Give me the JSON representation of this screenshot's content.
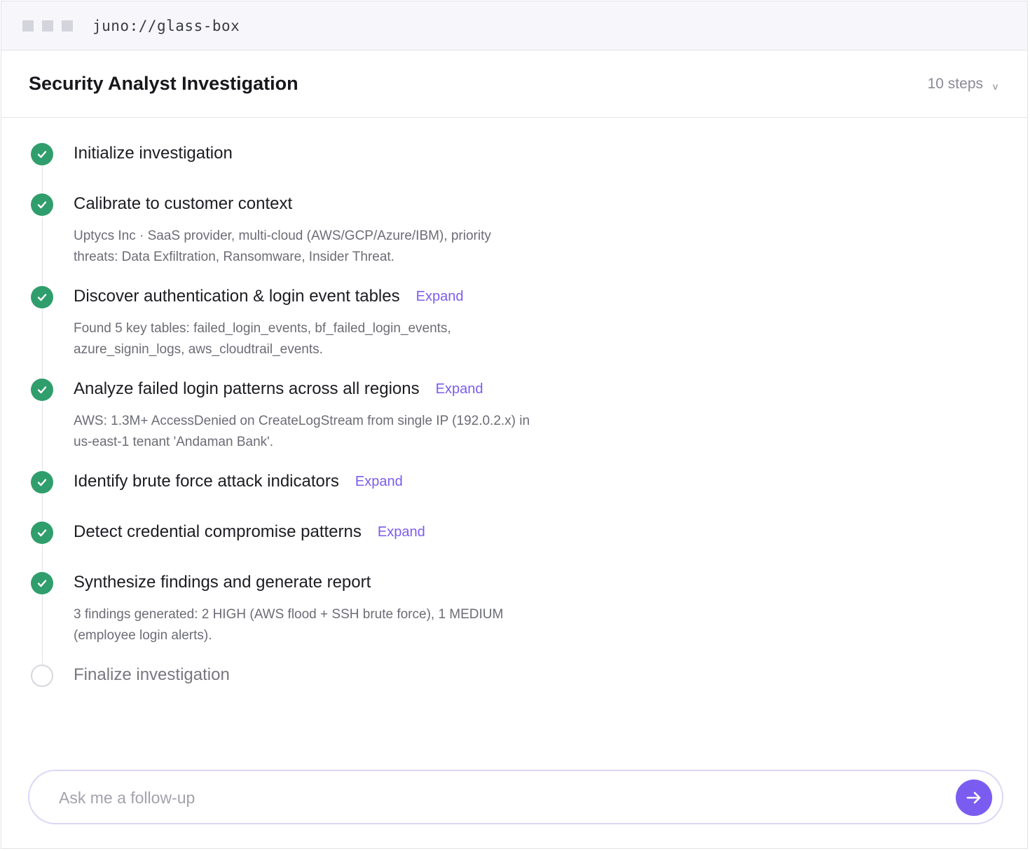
{
  "window": {
    "url": "juno://glass-box"
  },
  "header": {
    "title": "Security Analyst Investigation",
    "steps_label": "10 steps",
    "chevron": "v"
  },
  "steps": [
    {
      "title": "Initialize investigation",
      "status": "done",
      "expand": "",
      "desc": ""
    },
    {
      "title": "Calibrate to customer context",
      "status": "done",
      "expand": "",
      "desc": "Uptycs Inc · SaaS provider, multi-cloud (AWS/GCP/Azure/IBM), priority threats: Data Exfiltration, Ransomware, Insider Threat."
    },
    {
      "title": "Discover authentication & login event tables",
      "status": "done",
      "expand": "Expand",
      "desc": "Found 5 key tables: failed_login_events, bf_failed_login_events, azure_signin_logs, aws_cloudtrail_events."
    },
    {
      "title": "Analyze failed login patterns across all regions",
      "status": "done",
      "expand": "Expand",
      "desc": "AWS: 1.3M+ AccessDenied on CreateLogStream from single IP (192.0.2.x) in us-east-1 tenant 'Andaman Bank'."
    },
    {
      "title": "Identify brute force attack indicators",
      "status": "done",
      "expand": "Expand",
      "desc": ""
    },
    {
      "title": "Detect credential compromise patterns",
      "status": "done",
      "expand": "Expand",
      "desc": ""
    },
    {
      "title": "Synthesize findings and generate report",
      "status": "done",
      "expand": "",
      "desc": "3 findings generated: 2 HIGH (AWS flood + SSH brute force), 1 MEDIUM (employee login alerts)."
    },
    {
      "title": "Finalize investigation",
      "status": "pending",
      "expand": "",
      "desc": ""
    }
  ],
  "followup": {
    "placeholder": "Ask me a follow-up",
    "value": ""
  },
  "colors": {
    "done": "#2f9e6c",
    "accent": "#7b5cf0",
    "input_border": "#dcd6f7"
  },
  "icons": {
    "done": "check-circle-icon",
    "pending": "empty-circle-icon",
    "send": "arrow-right-icon"
  }
}
